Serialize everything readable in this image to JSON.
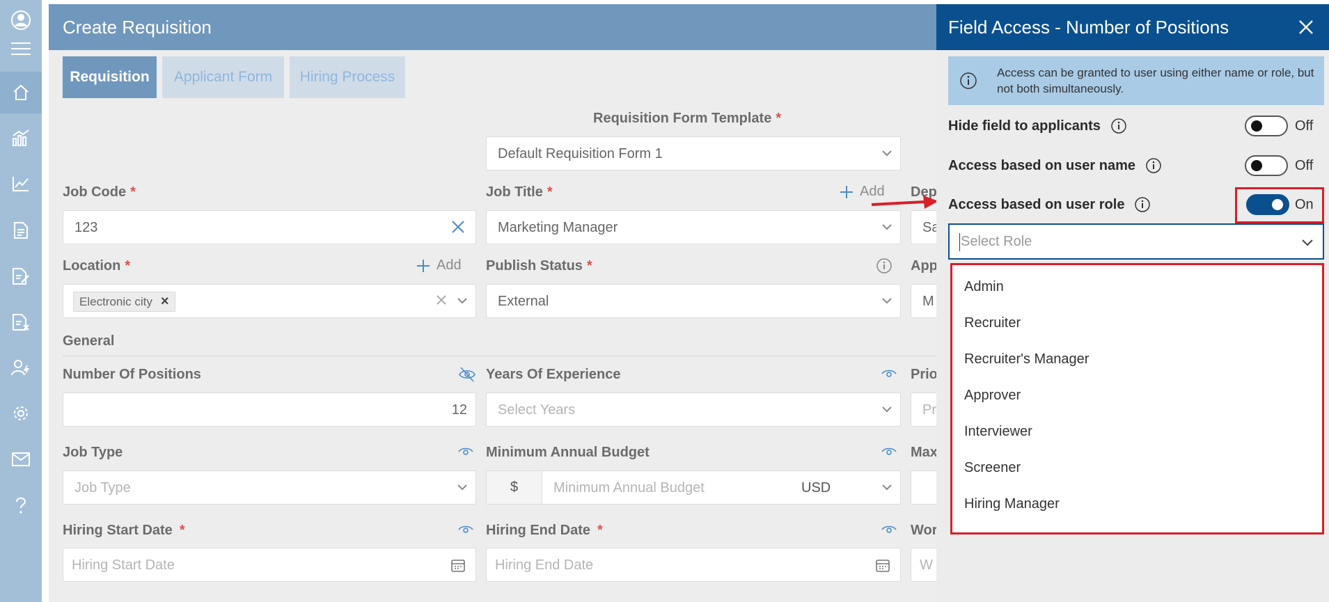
{
  "header": {
    "title": "Create Requisition"
  },
  "tabs": [
    {
      "label": "Requisition"
    },
    {
      "label": "Applicant Form"
    },
    {
      "label": "Hiring Process"
    }
  ],
  "form": {
    "template": {
      "label": "Requisition Form Template",
      "value": "Default Requisition Form 1"
    },
    "required_mark": "*",
    "add_label": "Add",
    "job_code": {
      "label": "Job Code",
      "value": "123"
    },
    "job_title": {
      "label": "Job Title",
      "value": "Marketing Manager"
    },
    "department": {
      "label": "Dep",
      "value": "Sa"
    },
    "location": {
      "label": "Location",
      "chip": "Electronic city",
      "chip_remove": "×"
    },
    "publish_status": {
      "label": "Publish Status",
      "value": "External"
    },
    "approval": {
      "label": "App",
      "value": "M"
    },
    "section_general": "General",
    "number_of_positions": {
      "label": "Number Of Positions",
      "value": "12"
    },
    "years_experience": {
      "label": "Years Of Experience",
      "placeholder": "Select Years"
    },
    "priority": {
      "label": "Prio",
      "placeholder": "Pr"
    },
    "job_type": {
      "label": "Job Type",
      "placeholder": "Job Type"
    },
    "min_budget": {
      "label": "Minimum Annual Budget",
      "currency_symbol": "$",
      "placeholder": "Minimum Annual Budget",
      "currency": "USD"
    },
    "max_budget": {
      "label": "Max"
    },
    "hiring_start": {
      "label": "Hiring Start Date",
      "placeholder": "Hiring Start Date"
    },
    "hiring_end": {
      "label": "Hiring End Date",
      "placeholder": "Hiring End Date"
    },
    "work": {
      "label": "Wor",
      "placeholder": "W"
    }
  },
  "panel": {
    "title": "Field Access - Number of Positions",
    "info": "Access can be granted to user using either name or role, but not both simultaneously.",
    "toggles": [
      {
        "label": "Hide field to applicants",
        "state": "Off"
      },
      {
        "label": "Access based on user name",
        "state": "Off"
      },
      {
        "label": "Access based on user role",
        "state": "On"
      }
    ],
    "select_role_placeholder": "Select Role",
    "roles": [
      "Admin",
      "Recruiter",
      "Recruiter's Manager",
      "Approver",
      "Interviewer",
      "Screener",
      "Hiring Manager"
    ]
  },
  "colors": {
    "sidebar": "#a3bfd8",
    "header": "#7097bc",
    "panel_header": "#0a508f",
    "highlight": "#d81f2a",
    "info_box": "#a9cbe6"
  },
  "icons": [
    "user-icon",
    "menu-icon",
    "home-icon",
    "analytics-icon",
    "line-chart-icon",
    "document-icon",
    "document-edit-icon",
    "document-remove-icon",
    "user-settings-icon",
    "gear-icon",
    "mail-icon",
    "help-icon",
    "close-icon",
    "info-icon",
    "chevron-down-icon",
    "calendar-icon",
    "eye-icon",
    "eye-off-icon",
    "plus-icon",
    "red-arrow"
  ]
}
